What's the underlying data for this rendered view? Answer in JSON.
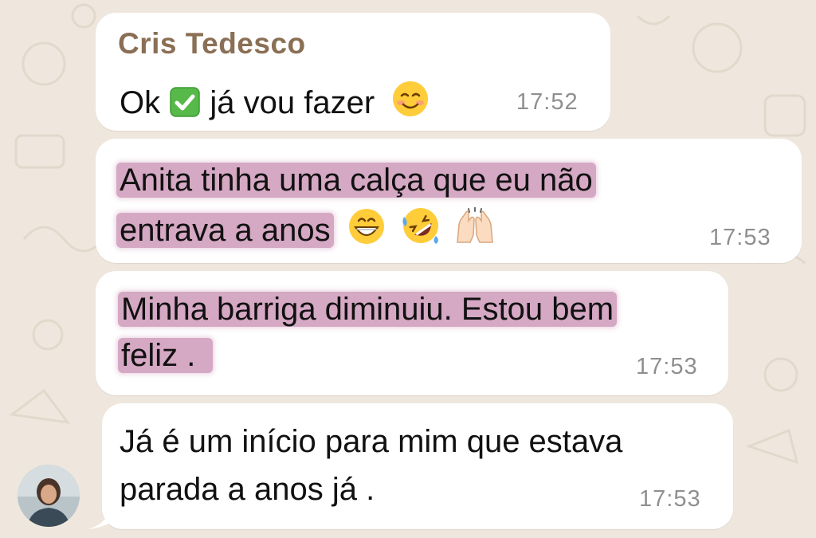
{
  "messages": [
    {
      "sender": "Cris Tedesco",
      "text_before": "Ok",
      "text_after": "já vou fazer",
      "time": "17:52"
    },
    {
      "line1": "Anita tinha uma calça que eu não",
      "line2": "entrava a anos",
      "time": "17:53"
    },
    {
      "line1": "Minha barriga diminuiu. Estou bem",
      "line2": "feliz .",
      "time": "17:53"
    },
    {
      "line1": "Já é um início para mim que estava",
      "line2": "parada a anos já .",
      "time": "17:53"
    }
  ],
  "icons": {
    "check": "check-mark-button-emoji",
    "smile": "smiling-face-emoji",
    "grin": "grinning-face-emoji",
    "rofl": "rolling-on-floor-laughing-emoji",
    "hands": "raising-hands-emoji"
  },
  "colors": {
    "chat_background": "#efe7dd",
    "bubble": "#ffffff",
    "sender_name": "#8a6f55",
    "highlight": "#b26092",
    "timestamp": "#8f8f8f"
  }
}
